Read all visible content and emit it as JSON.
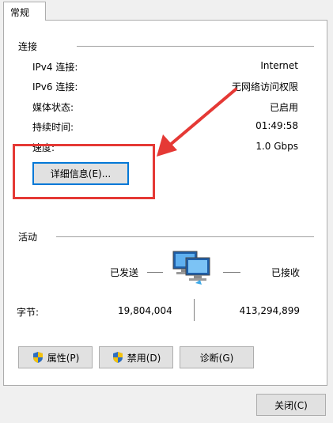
{
  "tab": {
    "label": "常规"
  },
  "connection": {
    "title": "连接",
    "rows": [
      {
        "label": "IPv4 连接:",
        "value": "Internet"
      },
      {
        "label": "IPv6 连接:",
        "value": "无网络访问权限"
      },
      {
        "label": "媒体状态:",
        "value": "已启用"
      },
      {
        "label": "持续时间:",
        "value": "01:49:58"
      },
      {
        "label": "速度:",
        "value": "1.0 Gbps"
      }
    ],
    "details_button": "详细信息(E)..."
  },
  "activity": {
    "title": "活动",
    "sent_label": "已发送",
    "received_label": "已接收",
    "bytes_label": "字节:",
    "bytes_sent": "19,804,004",
    "bytes_received": "413,294,899"
  },
  "buttons": {
    "properties": "属性(P)",
    "disable": "禁用(D)",
    "diagnose": "诊断(G)",
    "close": "关闭(C)"
  },
  "colors": {
    "highlight": "#e53935",
    "focus": "#0078d7"
  }
}
